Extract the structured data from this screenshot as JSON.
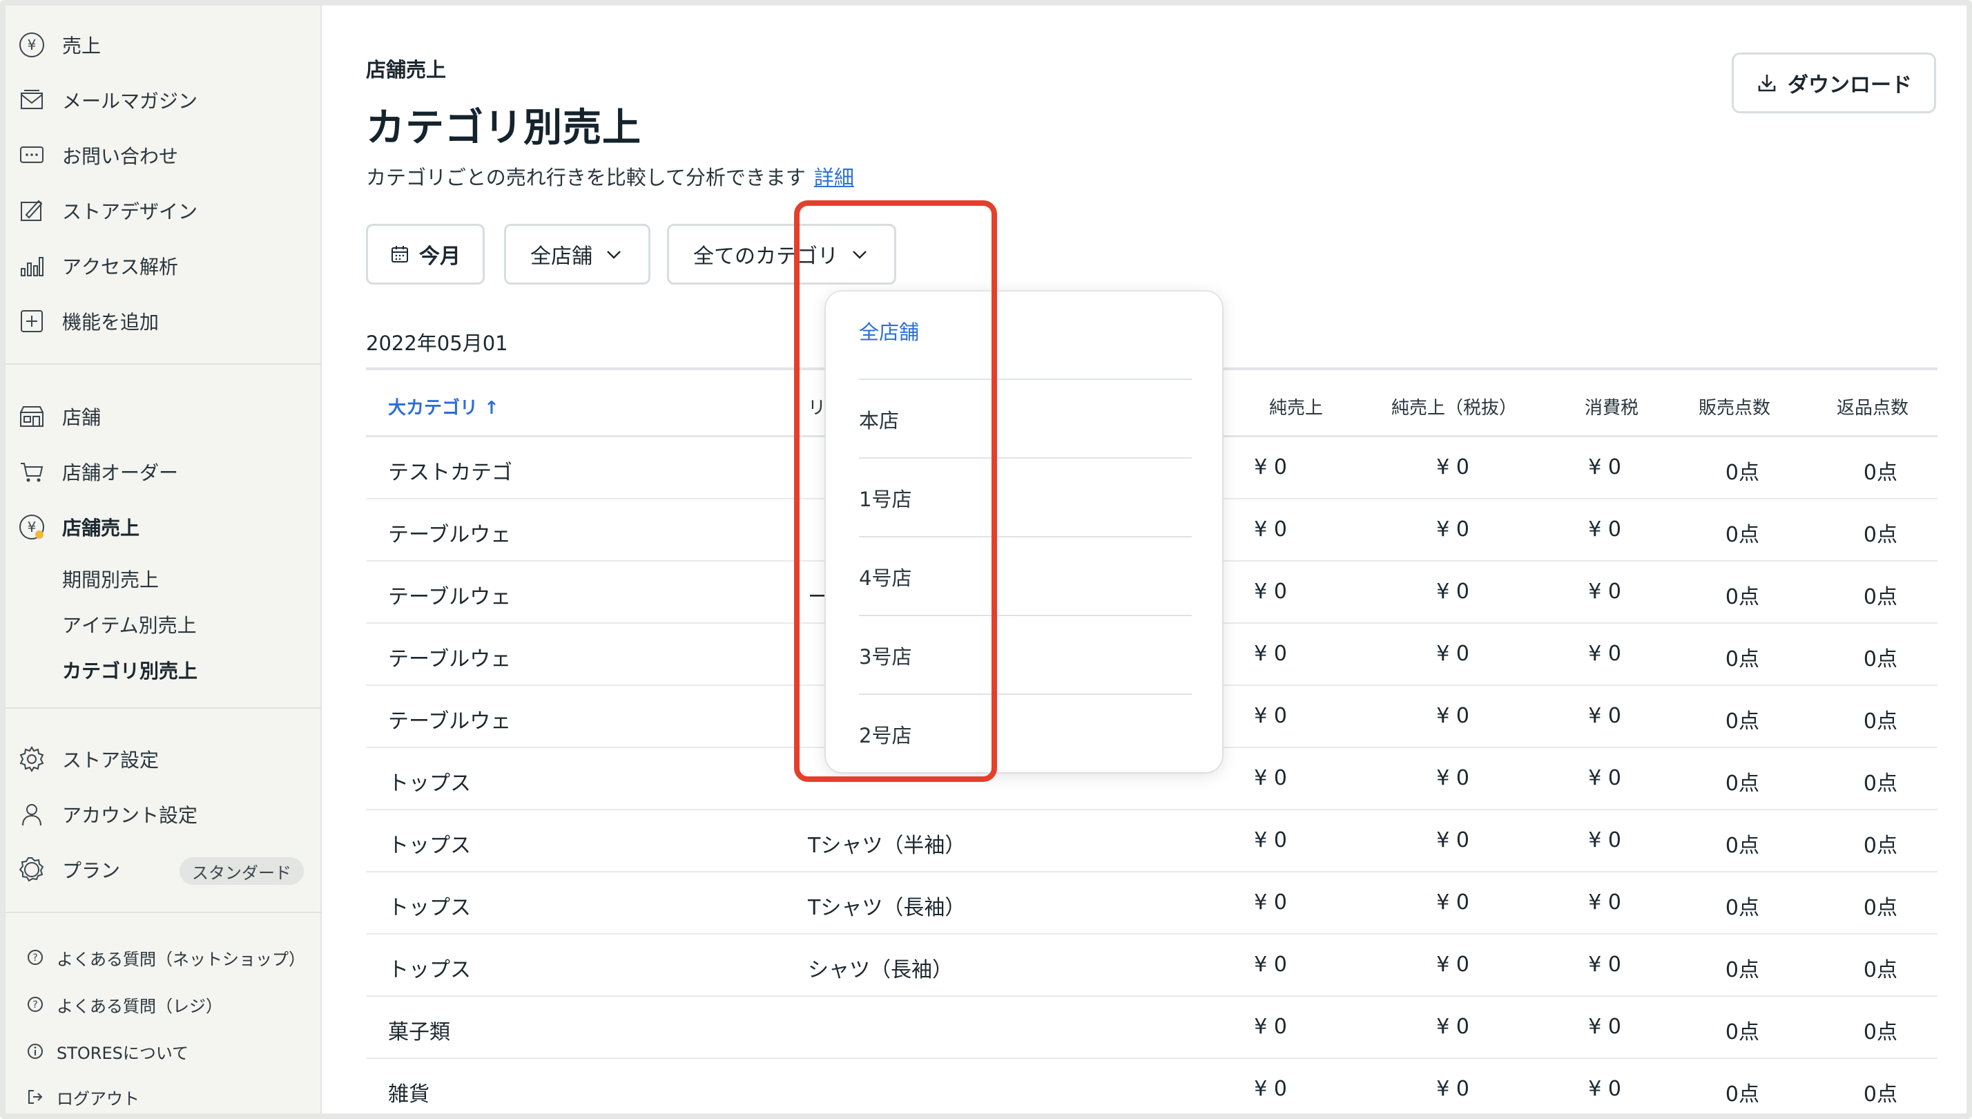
{
  "sidebar": {
    "nav_top": [
      {
        "label": "売上",
        "icon": "yen-circle-icon"
      },
      {
        "label": "メールマガジン",
        "icon": "mail-icon"
      },
      {
        "label": "お問い合わせ",
        "icon": "chat-icon"
      },
      {
        "label": "ストアデザイン",
        "icon": "design-icon"
      },
      {
        "label": "アクセス解析",
        "icon": "bar-chart-icon"
      },
      {
        "label": "機能を追加",
        "icon": "plus-square-icon"
      }
    ],
    "nav_store": [
      {
        "label": "店舗",
        "icon": "store-icon"
      },
      {
        "label": "店舗オーダー",
        "icon": "cart-icon"
      },
      {
        "label": "店舗売上",
        "icon": "yen-circle-icon"
      }
    ],
    "sub_items": [
      "期間別売上",
      "アイテム別売上",
      "カテゴリ別売上"
    ],
    "nav_settings": [
      {
        "label": "ストア設定",
        "icon": "gear-icon"
      },
      {
        "label": "アカウント設定",
        "icon": "person-icon"
      },
      {
        "label": "プラン",
        "icon": "badge-icon"
      }
    ],
    "plan_badge": "スタンダード",
    "footer_links": [
      {
        "label": "よくある質問（ネットショップ）",
        "icon": "question-icon"
      },
      {
        "label": "よくある質問（レジ）",
        "icon": "question-icon"
      },
      {
        "label": "STORESについて",
        "icon": "info-icon"
      },
      {
        "label": "ログアウト",
        "icon": "logout-icon"
      }
    ]
  },
  "header": {
    "breadcrumb": "店舗売上",
    "title": "カテゴリ別売上",
    "description": "カテゴリごとの売れ行きを比較して分析できます",
    "detail_link": "詳細",
    "download_label": "ダウンロード"
  },
  "filters": {
    "period_label": "今月",
    "store_label": "全店舗",
    "category_label": "全てのカテゴリ"
  },
  "date_range": "2022年05月01",
  "table": {
    "headers": [
      "大カテゴリ ↑",
      "リ",
      "純売上",
      "純売上（税抜）",
      "消費税",
      "販売点数",
      "返品点数"
    ],
    "rows": [
      [
        "テストカテゴ",
        "",
        "¥ 0",
        "¥ 0",
        "¥ 0",
        "0点",
        "0点"
      ],
      [
        "テーブルウェ",
        "",
        "¥ 0",
        "¥ 0",
        "¥ 0",
        "0点",
        "0点"
      ],
      [
        "テーブルウェ",
        "ー",
        "¥ 0",
        "¥ 0",
        "¥ 0",
        "0点",
        "0点"
      ],
      [
        "テーブルウェ",
        "",
        "¥ 0",
        "¥ 0",
        "¥ 0",
        "0点",
        "0点"
      ],
      [
        "テーブルウェ",
        "",
        "¥ 0",
        "¥ 0",
        "¥ 0",
        "0点",
        "0点"
      ],
      [
        "トップス",
        "",
        "¥ 0",
        "¥ 0",
        "¥ 0",
        "0点",
        "0点"
      ],
      [
        "トップス",
        "Tシャツ（半袖）",
        "¥ 0",
        "¥ 0",
        "¥ 0",
        "0点",
        "0点"
      ],
      [
        "トップス",
        "Tシャツ（長袖）",
        "¥ 0",
        "¥ 0",
        "¥ 0",
        "0点",
        "0点"
      ],
      [
        "トップス",
        "シャツ（長袖）",
        "¥ 0",
        "¥ 0",
        "¥ 0",
        "0点",
        "0点"
      ],
      [
        "菓子類",
        "",
        "¥ 0",
        "¥ 0",
        "¥ 0",
        "0点",
        "0点"
      ],
      [
        "雑貨",
        "",
        "¥ 0",
        "¥ 0",
        "¥ 0",
        "0点",
        "0点"
      ]
    ]
  },
  "dropdown": {
    "options": [
      "全店舗",
      "本店",
      "1号店",
      "4号店",
      "3号店",
      "2号店"
    ],
    "selected": "全店舗"
  },
  "colors": {
    "accent": "#2d6fd6",
    "highlight": "#e53f2b",
    "sidebar_bg": "#f4f4f0"
  }
}
